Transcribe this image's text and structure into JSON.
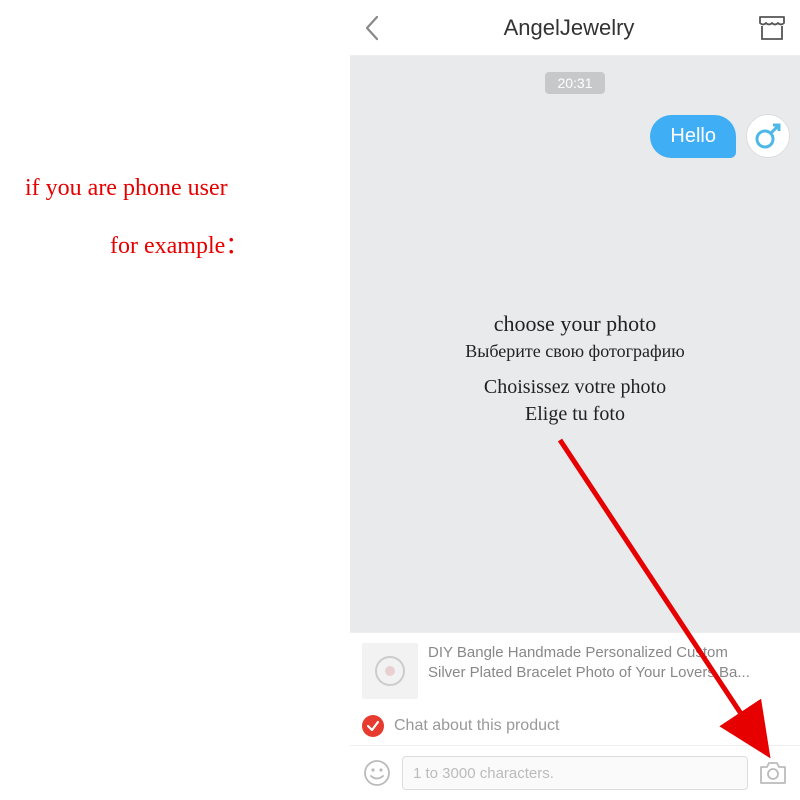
{
  "annotation": {
    "line1": "if you are phone user",
    "line2": "for example："
  },
  "header": {
    "title": "AngelJewelry"
  },
  "chat": {
    "timestamp": "20:31",
    "message": "Hello"
  },
  "overlay": {
    "en": "choose your photo",
    "ru": "Выберите свою фотографию",
    "fr": "Choisissez votre photo",
    "es": "Elige tu foto"
  },
  "product": {
    "line1": "DIY Bangle Handmade Personalized Custom",
    "line2": "Silver Plated Bracelet Photo of Your Lovers Ba..."
  },
  "chat_about": {
    "label": "Chat about this product"
  },
  "input": {
    "placeholder": "1 to 3000 characters."
  }
}
